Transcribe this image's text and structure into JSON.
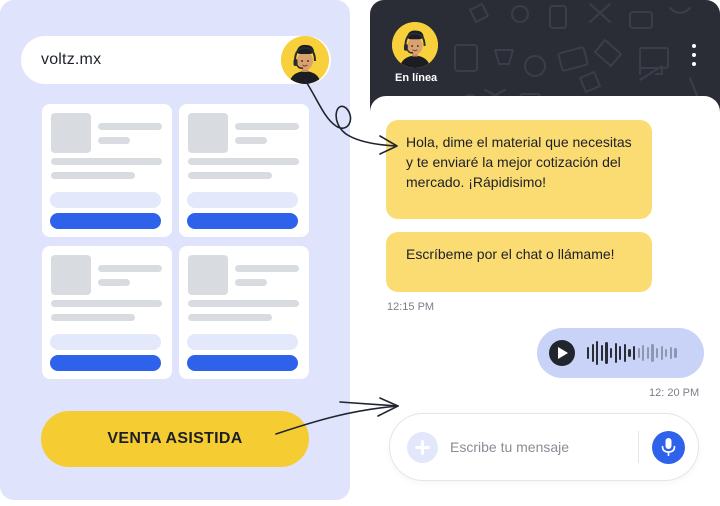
{
  "browser": {
    "url": "voltz.mx",
    "avatar_icon": "agent-avatar-icon",
    "assist_button_label": "VENTA ASISTIDA"
  },
  "chat": {
    "status": "En línea",
    "menu_icon": "more-vertical-icon",
    "messages": [
      {
        "from": "bot",
        "text": "Hola, dime el material que necesitas y te enviaré la mejor cotización del mercado. ¡Rápidisimo!"
      },
      {
        "from": "bot",
        "text": "Escríbeme por el chat o llámame!"
      }
    ],
    "bot_time": "12:15 PM",
    "user_audio": {
      "icon": "play-icon",
      "time": "12: 20 PM"
    },
    "input": {
      "placeholder": "Escribe tu mensaje",
      "value": ""
    },
    "add_icon": "plus-icon",
    "mic_icon": "microphone-icon"
  },
  "colors": {
    "panel_background": "#dfe3fb",
    "accent_blue": "#2f62ea",
    "accent_yellow": "#f6cc33",
    "bot_bubble": "#fadc73",
    "header_dark": "#2b2d36",
    "audio_bubble": "#c9d3f8"
  }
}
